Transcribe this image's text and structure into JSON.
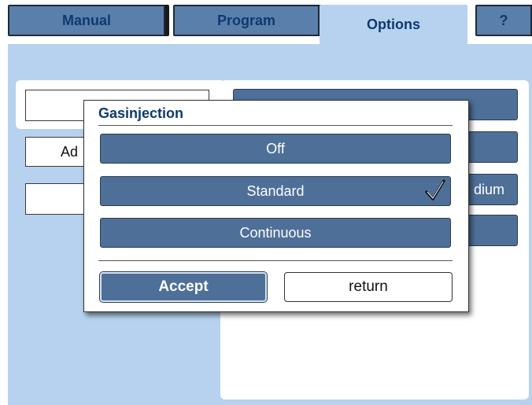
{
  "tabs": [
    {
      "label": "Manual",
      "active": false
    },
    {
      "label": "Program",
      "active": false
    },
    {
      "label": "Options",
      "active": true
    },
    {
      "label": "?",
      "active": false
    }
  ],
  "background": {
    "left_fields": [
      "",
      "Ad",
      ""
    ],
    "right_buttons": [
      "",
      "",
      "dium",
      ""
    ]
  },
  "dialog": {
    "title": "Gasinjection",
    "options": [
      {
        "label": "Off",
        "selected": false
      },
      {
        "label": "Standard",
        "selected": true
      },
      {
        "label": "Continuous",
        "selected": false
      }
    ],
    "accept_label": "Accept",
    "return_label": "return",
    "check_icon": "checkmark-icon"
  },
  "colors": {
    "accent": "#4e6f98",
    "background": "#b6d2ee",
    "title_text": "#0e3a70"
  }
}
